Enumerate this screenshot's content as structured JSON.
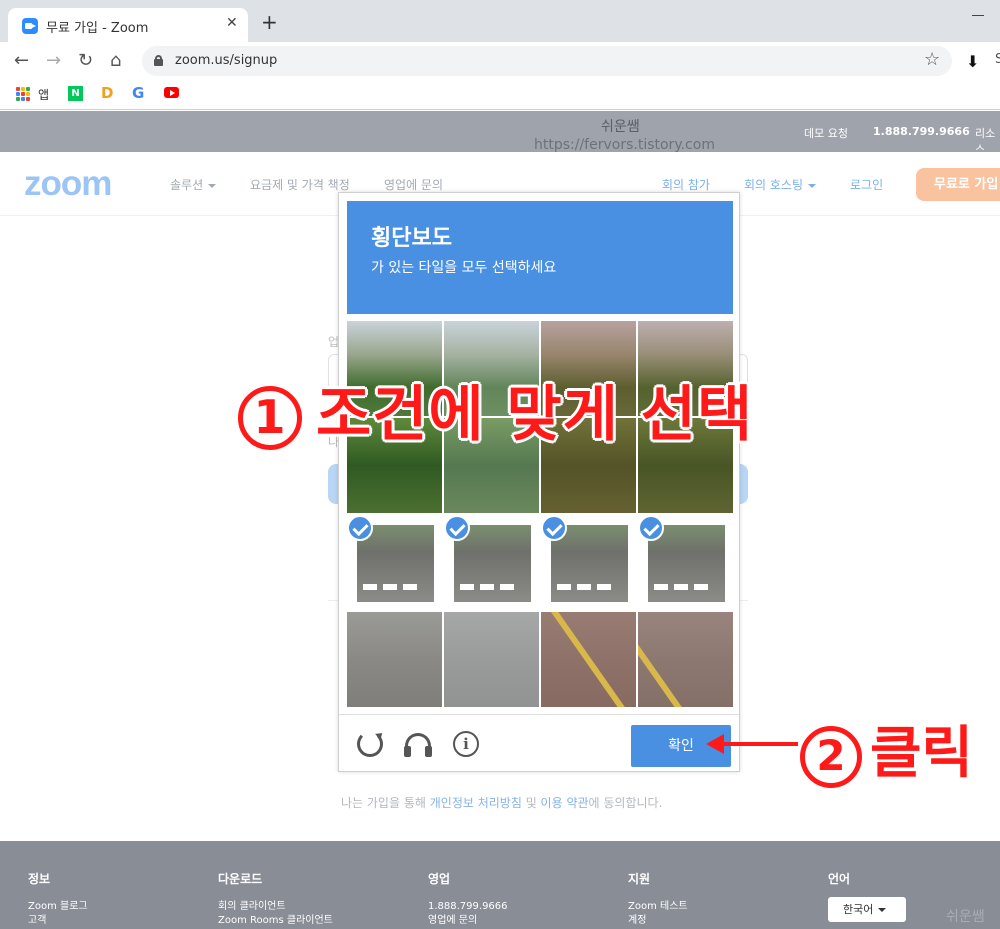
{
  "browser": {
    "tab_title": "무료 가입 - Zoom",
    "tab_close": "✕",
    "new_tab": "+",
    "url": "zoom.us/signup",
    "bookmarks": {
      "apps_label": "앱",
      "naver_letter": "N",
      "daum_letter": "D",
      "google_letter": "G"
    },
    "menu_letter": "S"
  },
  "watermark": {
    "title": "쉬운쌤",
    "url": "https://fervors.tistory.com",
    "bottom": "쉬운쌤"
  },
  "topbar": {
    "demo": "데모 요청",
    "phone": "1.888.799.9666",
    "resources": "리소스"
  },
  "zoom_nav": {
    "logo": "zoom",
    "solutions": "솔루션",
    "pricing": "요금제 및 가격 책정",
    "sales": "영업에 문의",
    "join": "회의 참가",
    "host": "회의 호스팅",
    "login": "로그인",
    "signup": "무료로 가입"
  },
  "form_ghost": {
    "label1": "업",
    "label2": "나"
  },
  "consent": {
    "prefix": "나는 가입을 통해 ",
    "privacy": "개인정보 처리방침",
    "and": " 및 ",
    "terms": "이용 약관",
    "suffix": "에 동의합니다."
  },
  "captcha": {
    "title": "횡단보도",
    "subtitle": "가 있는 타일을 모두 선택하세요",
    "verify": "확인",
    "info_glyph": "i",
    "selected_tiles": [
      8,
      9,
      10,
      11
    ]
  },
  "annotations": {
    "step1_num": "1",
    "step1_text": "조건에 맞게 선택",
    "step2_num": "2",
    "step2_text": "클릭"
  },
  "footer": {
    "col1": {
      "head": "정보",
      "items": [
        "Zoom 블로그",
        "고객"
      ]
    },
    "col2": {
      "head": "다운로드",
      "items": [
        "회의 클라이언트",
        "Zoom Rooms 클라이언트"
      ]
    },
    "col3": {
      "head": "영업",
      "items": [
        "1.888.799.9666",
        "영업에 문의"
      ]
    },
    "col4": {
      "head": "지원",
      "items": [
        "Zoom 테스트",
        "계정"
      ]
    },
    "col5": {
      "head": "언어"
    },
    "language": "한국어"
  },
  "colors": {
    "captcha_blue": "#4a90e2",
    "annotation_red": "#ff1a1a",
    "zoom_logo": "#9bc5f5",
    "signup_orange": "#f9c3a0"
  }
}
